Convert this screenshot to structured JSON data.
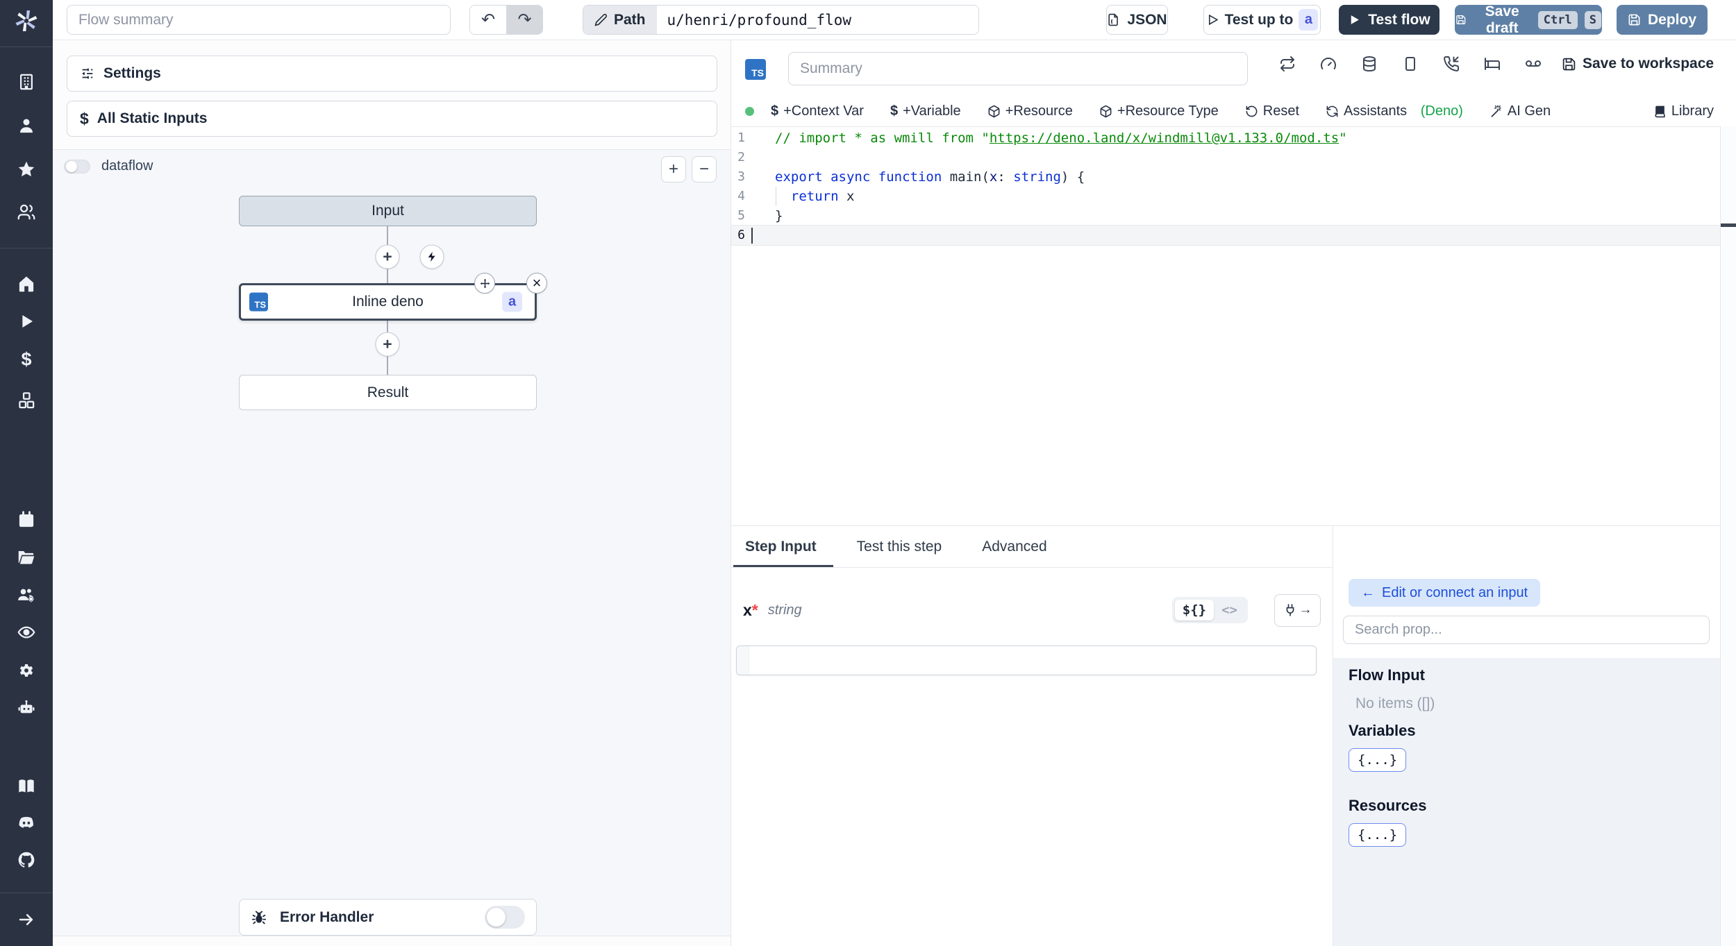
{
  "colors": {
    "sidebar_bg": "#2b3242",
    "accent_steel_blue": "#5f80a6",
    "dark_button": "#2c394a",
    "badge_indigo_bg": "#e3e7fd",
    "badge_indigo_text": "#4553d7",
    "ts_badge_blue": "#2f74c4",
    "green_status": "#58c07b",
    "deno_green": "#15a34a",
    "graph_bg": "#f5f7fa",
    "prop_gray": "#eff2f6"
  },
  "sidebar": {
    "icons": [
      "windmill-logo",
      "building",
      "user",
      "star",
      "users",
      "home",
      "play",
      "dollar",
      "boxes",
      "calendar",
      "folder-open",
      "users-cog",
      "eye",
      "settings-gear",
      "robot",
      "book",
      "discord",
      "github",
      "collapse-arrow"
    ]
  },
  "topbar": {
    "flow_summary_placeholder": "Flow summary",
    "undo_glyph": "↶",
    "redo_glyph": "↷",
    "path_label": "Path",
    "path_value": "u/henri/profound_flow",
    "json_button": "JSON",
    "test_up_to": "Test up to",
    "test_up_to_badge": "a",
    "test_flow": "Test flow",
    "save_draft": "Save draft",
    "kbd_ctrl": "Ctrl",
    "kbd_s": "S",
    "deploy": "Deploy"
  },
  "flow_panel": {
    "settings": "Settings",
    "all_static_inputs": "All Static Inputs",
    "static_dollar": "$",
    "dataflow_label": "dataflow",
    "zoom_in": "+",
    "zoom_out": "−",
    "nodes": {
      "input": "Input",
      "step_label": "Inline deno",
      "step_lang_badge": "TS",
      "step_id_badge": "a",
      "result": "Result",
      "plus_glyph": "+",
      "close_glyph": "×"
    },
    "error_handler": "Error Handler"
  },
  "editor": {
    "lang_badge": "TS",
    "summary_placeholder": "Summary",
    "save_to_workspace": "Save to workspace",
    "toolbar": {
      "dollar": "$",
      "context_var": "+Context Var",
      "variable": "+Variable",
      "resource": "+Resource",
      "resource_type": "+Resource Type",
      "reset": "Reset",
      "assistants": "Assistants",
      "assistants_lang": "(Deno)",
      "ai_gen": "AI Gen",
      "library": "Library"
    },
    "code": {
      "lines": [
        {
          "n": "1",
          "tokens": [
            {
              "s": "comment",
              "t": "// import * as wmill from \""
            },
            {
              "s": "comment-link",
              "t": "https://deno.land/x/windmill@v1.133.0/mod.ts"
            },
            {
              "s": "comment",
              "t": "\""
            }
          ]
        },
        {
          "n": "2",
          "tokens": []
        },
        {
          "n": "3",
          "tokens": [
            {
              "s": "keyword",
              "t": "export"
            },
            {
              "s": "plain",
              "t": " "
            },
            {
              "s": "keyword",
              "t": "async"
            },
            {
              "s": "plain",
              "t": " "
            },
            {
              "s": "keyword",
              "t": "function"
            },
            {
              "s": "plain",
              "t": " main("
            },
            {
              "s": "param",
              "t": "x"
            },
            {
              "s": "plain",
              "t": ": "
            },
            {
              "s": "type",
              "t": "string"
            },
            {
              "s": "plain",
              "t": ") {"
            }
          ]
        },
        {
          "n": "4",
          "guide": true,
          "tokens": [
            {
              "s": "plain",
              "t": "  "
            },
            {
              "s": "keyword",
              "t": "return"
            },
            {
              "s": "plain",
              "t": " x"
            }
          ]
        },
        {
          "n": "5",
          "tokens": [
            {
              "s": "plain",
              "t": "}"
            }
          ]
        },
        {
          "n": "6",
          "active": true,
          "cursor": true,
          "tokens": []
        }
      ]
    }
  },
  "tabs": {
    "0": "Step Input",
    "1": "Test this step",
    "2": "Advanced"
  },
  "step_input": {
    "field_name": "x",
    "required_marker": "*",
    "field_type": "string",
    "expr_toggle": "${}",
    "code_toggle": "<>",
    "plug_arrow": "→",
    "input_value": ""
  },
  "prop_picker": {
    "back_arrow": "←",
    "edit_button": "Edit or connect an input",
    "search_placeholder": "Search prop...",
    "flow_input_title": "Flow Input",
    "flow_input_empty": "No items ([])",
    "variables_title": "Variables",
    "variables_chip": "{...}",
    "resources_title": "Resources",
    "resources_chip": "{...}"
  }
}
